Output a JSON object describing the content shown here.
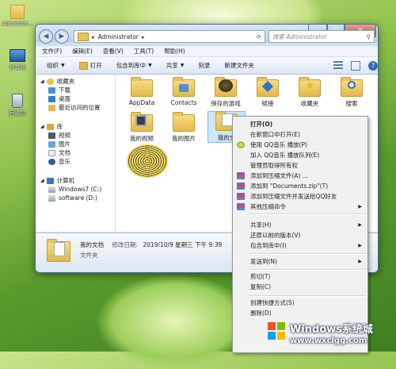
{
  "desktop": {
    "icons": [
      {
        "label": "Administr..."
      },
      {
        "label": "计算机"
      },
      {
        "label": "回收站"
      }
    ]
  },
  "window": {
    "nav_back": "◀",
    "nav_forward": "▶",
    "breadcrumb_arrow": "▸",
    "address": "Administrator",
    "address_chevron": "▸",
    "search_placeholder": "搜索 Administrator",
    "controls": {
      "minimize": "–",
      "maximize": "□",
      "close": "✕"
    },
    "menus": [
      "文件(F)",
      "编辑(E)",
      "查看(V)",
      "工具(T)",
      "帮助(H)"
    ],
    "toolbar": {
      "organize": "组织",
      "open": "打开",
      "include_library": "包含到库中",
      "share": "共享",
      "burn": "刻录",
      "new_folder": "新建文件夹"
    },
    "nav_pane": {
      "favorites_header": "收藏夹",
      "favorites": [
        "下载",
        "桌面",
        "最近访问的位置"
      ],
      "libraries_header": "库",
      "libraries": [
        "视频",
        "图片",
        "文档",
        "音乐"
      ],
      "computer_header": "计算机",
      "drives": [
        "Windows7 (C:)",
        "software (D:)"
      ]
    },
    "files": [
      {
        "name": "AppData",
        "kind": "folder"
      },
      {
        "name": "Contacts",
        "kind": "folder"
      },
      {
        "name": "保存的游戏",
        "kind": "games"
      },
      {
        "name": "链接",
        "kind": "links"
      },
      {
        "name": "收藏夹",
        "kind": "favorites"
      },
      {
        "name": "搜索",
        "kind": "search"
      },
      {
        "name": "我的视频",
        "kind": "video"
      },
      {
        "name": "我的图片",
        "kind": "pictures"
      },
      {
        "name": "我的文",
        "kind": "documents"
      }
    ],
    "details": {
      "name": "我的文档",
      "modified_label": "修改日期:",
      "modified_value": "2019/10/9 星期三 下午 9:39",
      "type": "文件夹"
    }
  },
  "context_menu": {
    "items": [
      {
        "label": "打开(O)",
        "bold": true
      },
      {
        "label": "在新窗口中打开(E)"
      },
      {
        "label": "使用 QQ音乐 播放(P)",
        "icon": "qq-music-icon"
      },
      {
        "label": "加入 QQ音乐 播放队列(E)"
      },
      {
        "label": "管理员取得所有权"
      },
      {
        "label": "添加到压缩文件(A) ...",
        "icon": "winrar-icon"
      },
      {
        "label": "添加到 \"Documents.zip\"(T)",
        "icon": "winrar-icon"
      },
      {
        "label": "添加到压缩文件并发送给QQ好友",
        "icon": "winrar-icon"
      },
      {
        "label": "其他压缩命令",
        "icon": "winrar-icon",
        "submenu": true
      },
      {
        "label": "共享(H)",
        "submenu": true
      },
      {
        "label": "还原以前的版本(V)"
      },
      {
        "label": "包含到库中(I)",
        "submenu": true
      },
      {
        "label": "发送到(N)",
        "submenu": true
      },
      {
        "label": "剪切(T)"
      },
      {
        "label": "复制(C)"
      },
      {
        "label": "创建快捷方式(S)"
      },
      {
        "label": "删除(D)"
      }
    ],
    "submenu_arrow": "▶"
  },
  "watermark": {
    "title": "Windows系统城",
    "url": "www.wxclgg.com"
  },
  "colors": {
    "window_frame": "#cfe0f0",
    "selection": "#cde6fb",
    "menu_bg": "#f1f1f1",
    "folder": "#e8c45a"
  }
}
